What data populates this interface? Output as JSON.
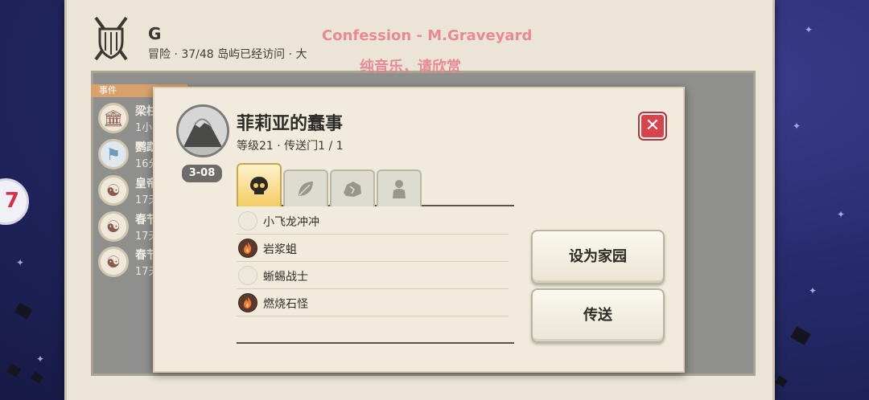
{
  "player": {
    "name": "G",
    "info": "冒险 · 37/48 岛屿已经访问 · 大"
  },
  "overlay": {
    "line1": "Confession - M.Graveyard",
    "line2": "纯音乐，请欣赏"
  },
  "edge_badge": "7",
  "events": {
    "header": "事件",
    "items": [
      {
        "title": "梁柱",
        "sub": "1小",
        "icon": "building-icon"
      },
      {
        "title": "鹦鹉",
        "sub": "16分",
        "icon": "flag-icon"
      },
      {
        "title": "皇帝",
        "sub": "17天",
        "icon": "yin-yang-icon"
      },
      {
        "title": "春节",
        "sub": "17天",
        "icon": "yin-yang-icon"
      },
      {
        "title": "春节",
        "sub": "17天",
        "icon": "yin-yang-icon"
      }
    ]
  },
  "dialog": {
    "title": "菲莉亚的蠢事",
    "subtitle": "等级21 · 传送门1 / 1",
    "tag": "3-08",
    "close_symbol": "✕",
    "tabs": [
      {
        "icon": "skull-icon",
        "active": true
      },
      {
        "icon": "leaf-icon",
        "active": false
      },
      {
        "icon": "rock-icon",
        "active": false
      },
      {
        "icon": "person-icon",
        "active": false
      }
    ],
    "creatures": [
      {
        "label": "小飞龙冲冲",
        "icon": "empty-circle-icon"
      },
      {
        "label": "岩浆蛆",
        "icon": "fire-icon"
      },
      {
        "label": "蜥蜴战士",
        "icon": "empty-circle-icon"
      },
      {
        "label": "燃烧石怪",
        "icon": "fire-icon"
      }
    ],
    "buttons": {
      "set_home": "设为家园",
      "teleport": "传送"
    }
  }
}
